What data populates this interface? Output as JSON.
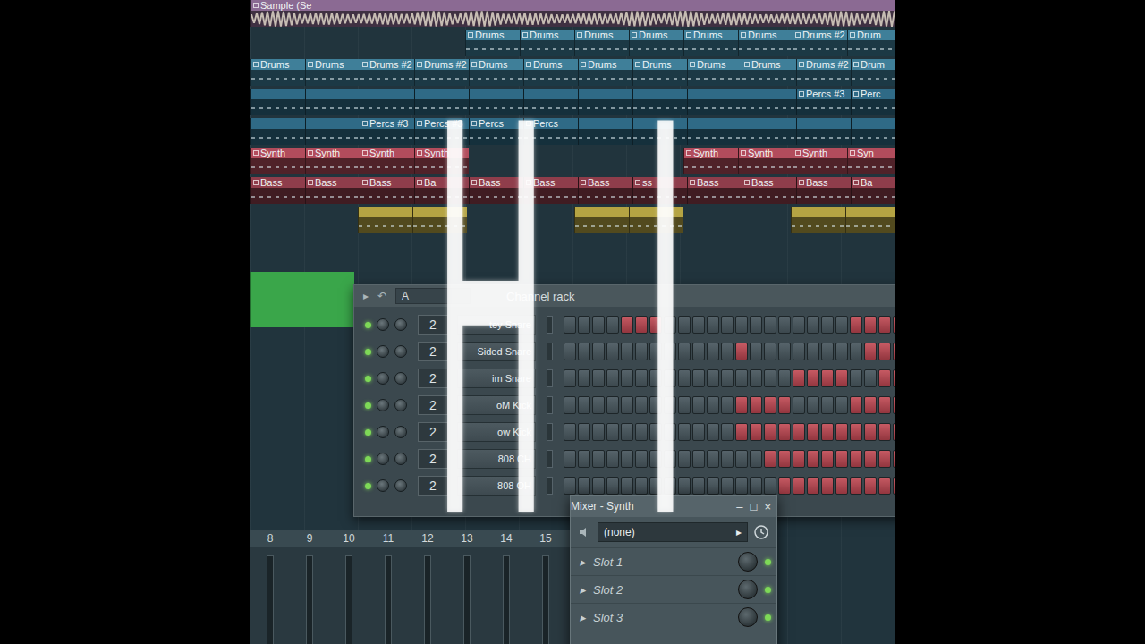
{
  "playlist": {
    "tracks": [
      {
        "color": "#8b6a93",
        "clips": [
          {
            "kind": "audio",
            "label": "Sample (Se"
          }
        ]
      },
      {
        "color": "#3f7f99",
        "clips": [
          {
            "kind": "gap",
            "label": ""
          },
          {
            "kind": "gap",
            "label": ""
          },
          {
            "kind": "gap",
            "label": ""
          },
          {
            "kind": "gap",
            "label": ""
          },
          {
            "kind": "clip",
            "label": "Drums"
          },
          {
            "kind": "clip",
            "label": "Drums"
          },
          {
            "kind": "clip",
            "label": "Drums"
          },
          {
            "kind": "clip",
            "label": "Drums"
          },
          {
            "kind": "clip",
            "label": "Drums"
          },
          {
            "kind": "clip",
            "label": "Drums"
          },
          {
            "kind": "clip",
            "label": "Drums #2"
          },
          {
            "kind": "clip",
            "label": "Drum"
          }
        ]
      },
      {
        "color": "#3f7f99",
        "clips": [
          {
            "kind": "clip",
            "label": "Drums"
          },
          {
            "kind": "clip",
            "label": "Drums"
          },
          {
            "kind": "clip",
            "label": "Drums #2"
          },
          {
            "kind": "clip",
            "label": "Drums #2"
          },
          {
            "kind": "clip",
            "label": "Drums"
          },
          {
            "kind": "clip",
            "label": "Drums"
          },
          {
            "kind": "clip",
            "label": "Drums"
          },
          {
            "kind": "clip",
            "label": "Drums"
          },
          {
            "kind": "clip",
            "label": "Drums"
          },
          {
            "kind": "clip",
            "label": "Drums"
          },
          {
            "kind": "clip",
            "label": "Drums #2"
          },
          {
            "kind": "clip",
            "label": "Drum"
          }
        ]
      },
      {
        "color": "#2f6a86",
        "clips": [
          {
            "kind": "clip",
            "label": ""
          },
          {
            "kind": "clip",
            "label": ""
          },
          {
            "kind": "clip",
            "label": ""
          },
          {
            "kind": "clip",
            "label": ""
          },
          {
            "kind": "clip",
            "label": ""
          },
          {
            "kind": "clip",
            "label": ""
          },
          {
            "kind": "clip",
            "label": ""
          },
          {
            "kind": "clip",
            "label": ""
          },
          {
            "kind": "clip",
            "label": ""
          },
          {
            "kind": "clip",
            "label": ""
          },
          {
            "kind": "clip",
            "label": "Percs #3"
          },
          {
            "kind": "clip",
            "label": "Perc"
          }
        ]
      },
      {
        "color": "#2f6a86",
        "clips": [
          {
            "kind": "clip",
            "label": ""
          },
          {
            "kind": "clip",
            "label": ""
          },
          {
            "kind": "clip",
            "label": "Percs #3"
          },
          {
            "kind": "clip",
            "label": "Percs #3"
          },
          {
            "kind": "clip",
            "label": "Percs"
          },
          {
            "kind": "clip",
            "label": "Percs"
          },
          {
            "kind": "clip",
            "label": ""
          },
          {
            "kind": "clip",
            "label": ""
          },
          {
            "kind": "clip",
            "label": ""
          },
          {
            "kind": "clip",
            "label": ""
          },
          {
            "kind": "clip",
            "label": ""
          },
          {
            "kind": "clip",
            "label": ""
          }
        ]
      },
      {
        "color": "#b24c5c",
        "clips": [
          {
            "kind": "clip",
            "label": "Synth"
          },
          {
            "kind": "clip",
            "label": "Synth"
          },
          {
            "kind": "clip",
            "label": "Synth"
          },
          {
            "kind": "clip",
            "label": "Synth"
          },
          {
            "kind": "gap",
            "label": ""
          },
          {
            "kind": "gap",
            "label": ""
          },
          {
            "kind": "gap",
            "label": ""
          },
          {
            "kind": "gap",
            "label": ""
          },
          {
            "kind": "clip",
            "label": "Synth"
          },
          {
            "kind": "clip",
            "label": "Synth"
          },
          {
            "kind": "clip",
            "label": "Synth"
          },
          {
            "kind": "clip",
            "label": "Syn"
          }
        ]
      },
      {
        "color": "#8f3d4b",
        "clips": [
          {
            "kind": "clip",
            "label": "Bass"
          },
          {
            "kind": "clip",
            "label": "Bass"
          },
          {
            "kind": "clip",
            "label": "Bass"
          },
          {
            "kind": "clip",
            "label": "Ba"
          },
          {
            "kind": "clip",
            "label": "Bass"
          },
          {
            "kind": "clip",
            "label": "Bass"
          },
          {
            "kind": "clip",
            "label": "Bass"
          },
          {
            "kind": "clip",
            "label": "ss"
          },
          {
            "kind": "clip",
            "label": "Bass"
          },
          {
            "kind": "clip",
            "label": "Bass"
          },
          {
            "kind": "clip",
            "label": "Bass"
          },
          {
            "kind": "clip",
            "label": "Ba"
          }
        ]
      },
      {
        "color": "#b5a443",
        "clips": [
          {
            "kind": "gap",
            "label": ""
          },
          {
            "kind": "gap",
            "label": ""
          },
          {
            "kind": "clip",
            "label": ""
          },
          {
            "kind": "clip",
            "label": ""
          },
          {
            "kind": "gap",
            "label": ""
          },
          {
            "kind": "gap",
            "label": ""
          },
          {
            "kind": "clip",
            "label": ""
          },
          {
            "kind": "clip",
            "label": ""
          },
          {
            "kind": "gap",
            "label": ""
          },
          {
            "kind": "gap",
            "label": ""
          },
          {
            "kind": "clip",
            "label": ""
          },
          {
            "kind": "clip",
            "label": ""
          }
        ]
      },
      {
        "color": "#3aa64a",
        "clips": [
          {
            "kind": "automation",
            "label": ""
          }
        ]
      }
    ]
  },
  "channel_rack": {
    "title": "Channel rack",
    "pattern": "A",
    "nav": [
      "▸",
      "↶"
    ],
    "channels": [
      {
        "name": "tey Snare",
        "number": "2",
        "enabled": true,
        "steps": [
          false,
          false,
          false,
          false,
          true,
          true,
          true,
          false,
          false,
          false,
          false,
          false,
          false,
          false,
          false,
          false,
          false,
          false,
          false,
          false,
          true,
          true,
          true,
          true
        ]
      },
      {
        "name": "Sided Snare",
        "number": "2",
        "enabled": true,
        "steps": [
          false,
          false,
          false,
          false,
          false,
          false,
          false,
          false,
          false,
          false,
          false,
          false,
          true,
          false,
          false,
          false,
          false,
          false,
          false,
          false,
          false,
          true,
          true,
          true
        ]
      },
      {
        "name": "im Snare",
        "number": "2",
        "enabled": true,
        "steps": [
          false,
          false,
          false,
          false,
          false,
          false,
          false,
          false,
          false,
          false,
          false,
          false,
          false,
          false,
          false,
          false,
          true,
          true,
          true,
          true,
          false,
          false,
          true,
          true
        ]
      },
      {
        "name": "oM Kick",
        "number": "2",
        "enabled": true,
        "steps": [
          false,
          false,
          false,
          false,
          false,
          false,
          false,
          false,
          false,
          false,
          false,
          false,
          true,
          true,
          true,
          true,
          false,
          false,
          false,
          false,
          true,
          true,
          true,
          true
        ]
      },
      {
        "name": "ow Kick",
        "number": "2",
        "enabled": true,
        "steps": [
          false,
          false,
          false,
          false,
          false,
          false,
          false,
          false,
          false,
          false,
          false,
          false,
          true,
          true,
          true,
          true,
          true,
          true,
          true,
          true,
          true,
          true,
          true,
          true
        ]
      },
      {
        "name": "808 CH",
        "number": "2",
        "enabled": true,
        "steps": [
          false,
          false,
          false,
          false,
          false,
          false,
          false,
          false,
          false,
          false,
          false,
          false,
          false,
          false,
          true,
          true,
          true,
          true,
          true,
          true,
          true,
          true,
          true,
          true
        ]
      },
      {
        "name": "808 OH",
        "number": "2",
        "enabled": true,
        "steps": [
          false,
          false,
          false,
          false,
          false,
          false,
          false,
          false,
          false,
          false,
          false,
          false,
          false,
          false,
          false,
          true,
          true,
          true,
          true,
          true,
          true,
          true,
          true,
          true
        ]
      }
    ]
  },
  "mixer_strip": {
    "inserts": [
      "8",
      "9",
      "10",
      "11",
      "12",
      "13",
      "14",
      "15"
    ]
  },
  "mixer_window": {
    "title": "Mixer - Synth",
    "controls": [
      "–",
      "□",
      "×"
    ],
    "route": "(none)",
    "arrow": "▸",
    "slots": [
      {
        "label": "Slot 1",
        "enabled": true
      },
      {
        "label": "Slot 2",
        "enabled": true
      },
      {
        "label": "Slot 3",
        "enabled": true
      }
    ]
  },
  "annotation": {
    "text": "HI"
  }
}
